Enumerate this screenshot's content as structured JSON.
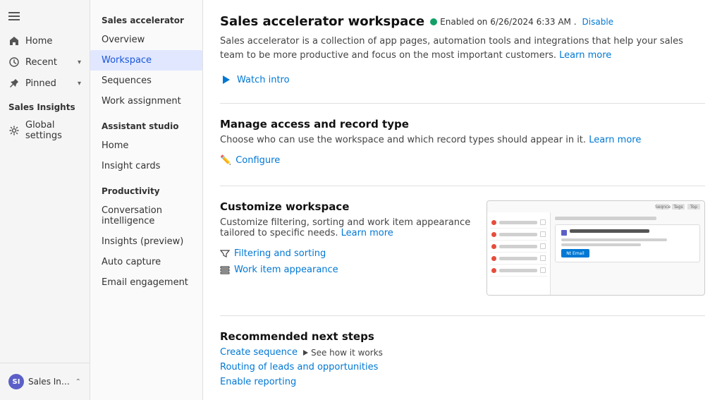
{
  "leftNav": {
    "items": [
      {
        "id": "home",
        "label": "Home",
        "icon": "home"
      },
      {
        "id": "recent",
        "label": "Recent",
        "icon": "recent",
        "hasChevron": true
      },
      {
        "id": "pinned",
        "label": "Pinned",
        "icon": "pinned",
        "hasChevron": true
      }
    ],
    "sectionLabel": "Sales Insights",
    "globalSettings": {
      "label": "Global settings",
      "icon": "gear"
    }
  },
  "bottomBar": {
    "initials": "SI",
    "label": "Sales Insights sett...",
    "hasChevron": true
  },
  "sidebar": {
    "salesAcceleratorLabel": "Sales accelerator",
    "items": [
      {
        "id": "overview",
        "label": "Overview",
        "active": false
      },
      {
        "id": "workspace",
        "label": "Workspace",
        "active": true
      },
      {
        "id": "sequences",
        "label": "Sequences",
        "active": false
      },
      {
        "id": "work-assignment",
        "label": "Work assignment",
        "active": false
      }
    ],
    "assistantStudioLabel": "Assistant studio",
    "assistantItems": [
      {
        "id": "home-as",
        "label": "Home",
        "active": false
      },
      {
        "id": "insight-cards",
        "label": "Insight cards",
        "active": false
      }
    ],
    "productivityLabel": "Productivity",
    "productivityItems": [
      {
        "id": "conversation-intelligence",
        "label": "Conversation intelligence",
        "active": false
      },
      {
        "id": "insights-preview",
        "label": "Insights (preview)",
        "active": false
      },
      {
        "id": "auto-capture",
        "label": "Auto capture",
        "active": false
      },
      {
        "id": "email-engagement",
        "label": "Email engagement",
        "active": false
      }
    ]
  },
  "main": {
    "title": "Sales accelerator workspace",
    "statusText": "Enabled on 6/26/2024 6:33 AM .",
    "disableLabel": "Disable",
    "description": "Sales accelerator is a collection of app pages, automation tools and integrations that help your sales team to be more productive and focus on the most important customers.",
    "learnMoreLabel": "Learn more",
    "watchIntroLabel": "Watch intro",
    "sections": {
      "manageAccess": {
        "title": "Manage access and record type",
        "description": "Choose who can use the workspace and which record types should appear in it.",
        "learnMoreLabel": "Learn more",
        "configureLabel": "Configure"
      },
      "customizeWorkspace": {
        "title": "Customize workspace",
        "description": "Customize filtering, sorting and work item appearance tailored to specific needs.",
        "learnMoreLabel": "Learn more",
        "filteringLabel": "Filtering and sorting",
        "workItemLabel": "Work item appearance",
        "previewTopBar": [
          "Sequence",
          "Tags",
          "Top"
        ],
        "previewDots": [
          {
            "color": "#e74c3c"
          },
          {
            "color": "#e74c3c"
          },
          {
            "color": "#e74c3c"
          },
          {
            "color": "#e74c3c"
          },
          {
            "color": "#e74c3c"
          }
        ],
        "previewCardTitle": "Email",
        "previewCardBtnLabel": "Nt Email"
      },
      "recommendedNextSteps": {
        "title": "Recommended next steps",
        "links": [
          {
            "id": "create-sequence",
            "label": "Create sequence",
            "hasSeeHow": true,
            "seeHowLabel": "See how it works"
          },
          {
            "id": "routing",
            "label": "Routing of leads and opportunities",
            "hasSeeHow": false
          },
          {
            "id": "enable-reporting",
            "label": "Enable reporting",
            "hasSeeHow": false
          }
        ]
      }
    }
  }
}
